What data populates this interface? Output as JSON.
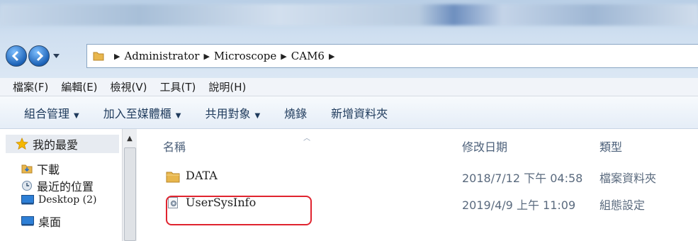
{
  "address": {
    "crumbs": [
      "Administrator",
      "Microscope",
      "CAM6"
    ]
  },
  "menu": [
    "檔案(F)",
    "編輯(E)",
    "檢視(V)",
    "工具(T)",
    "說明(H)"
  ],
  "commands": [
    {
      "label": "組合管理",
      "has_dropdown": true
    },
    {
      "label": "加入至媒體櫃",
      "has_dropdown": true
    },
    {
      "label": "共用對象",
      "has_dropdown": true
    },
    {
      "label": "燒錄",
      "has_dropdown": false
    },
    {
      "label": "新增資料夾",
      "has_dropdown": false
    }
  ],
  "navpane": {
    "favorites": "我的最愛",
    "items": [
      "下載",
      "最近的位置",
      "Desktop (2)",
      "桌面"
    ]
  },
  "columns": {
    "name": "名稱",
    "date": "修改日期",
    "type": "類型"
  },
  "files": [
    {
      "name": "DATA",
      "date": "2018/7/12 下午 04:58",
      "type": "檔案資料夾",
      "icon": "folder-icon"
    },
    {
      "name": "UserSysInfo",
      "date": "2019/4/9 上午 11:09",
      "type": "組態設定",
      "icon": "config-file-icon"
    }
  ],
  "colors": {
    "accent": "#1d63b8",
    "highlight_outline": "#e0242f",
    "folder": "#e8b64c"
  }
}
